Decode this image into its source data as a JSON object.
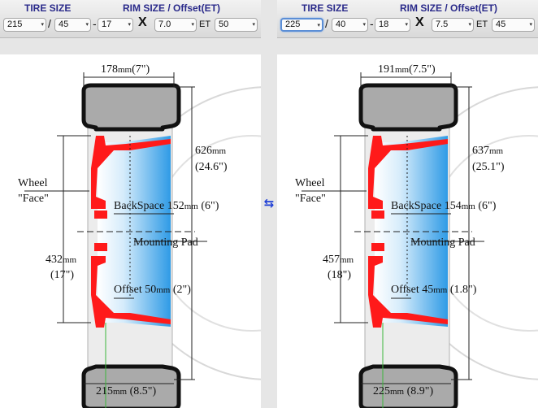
{
  "swap_icon": "swap-arrows-icon",
  "left": {
    "header": {
      "tire_size": "TIRE SIZE",
      "rim_size": "RIM SIZE / Offset(ET)"
    },
    "inputs": {
      "width": "215",
      "aspect": "45",
      "diameter": "17",
      "rim_width": "7.0",
      "et_label": "ET",
      "et": "50"
    },
    "seps": {
      "slash": "/",
      "dash": "-",
      "x": "X"
    },
    "labels": {
      "top_w": "178",
      "top_w_unit": "mm",
      "top_w_in": "(7\")",
      "od": "626",
      "od_unit": "mm",
      "od_in": "(24.6\")",
      "wheel": "Wheel",
      "face": "\"Face\"",
      "backspace_label": "BackSpace",
      "backspace": "152",
      "backspace_unit": "mm",
      "backspace_in": "(6\")",
      "mounting": "Mounting Pad",
      "rim_d": "432",
      "rim_d_unit": "mm",
      "rim_d_in": "(17\")",
      "offset_label": "Offset",
      "offset": "50",
      "offset_unit": "mm",
      "offset_in": "(2\")",
      "bottom_w": "215",
      "bottom_w_unit": "mm",
      "bottom_w_in": "(8.5\")"
    }
  },
  "right": {
    "header": {
      "tire_size": "TIRE SIZE",
      "rim_size": "RIM SIZE / Offset(ET)"
    },
    "inputs": {
      "width": "225",
      "aspect": "40",
      "diameter": "18",
      "rim_width": "7.5",
      "et_label": "ET",
      "et": "45"
    },
    "seps": {
      "slash": "/",
      "dash": "-",
      "x": "X"
    },
    "labels": {
      "top_w": "191",
      "top_w_unit": "mm",
      "top_w_in": "(7.5\")",
      "od": "637",
      "od_unit": "mm",
      "od_in": "(25.1\")",
      "wheel": "Wheel",
      "face": "\"Face\"",
      "backspace_label": "BackSpace",
      "backspace": "154",
      "backspace_unit": "mm",
      "backspace_in": "(6\")",
      "mounting": "Mounting Pad",
      "rim_d": "457",
      "rim_d_unit": "mm",
      "rim_d_in": "(18\")",
      "offset_label": "Offset",
      "offset": "45",
      "offset_unit": "mm",
      "offset_in": "(1.8\")",
      "bottom_w": "225",
      "bottom_w_unit": "mm",
      "bottom_w_in": "(8.9\")"
    }
  }
}
